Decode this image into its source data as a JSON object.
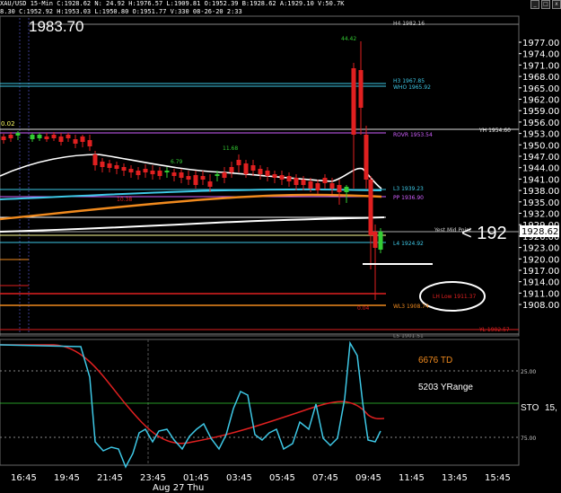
{
  "header": {
    "line1": "XAU/USD  15-Min  C:1928.62  N:  24.92  H:1976.57  L:1909.81  O:1952.39  B:1928.62  A:1929.10  V:50.7K",
    "line2": "8.30  C:1952.92  H:1953.03  L:1950.80  O:1951.77  V:330  08-26-20  2:33"
  },
  "big_price": "1983.70",
  "window_buttons": [
    "_",
    "□",
    "x"
  ],
  "right_axis": [
    "1977.00",
    "1974.00",
    "1971.00",
    "1968.00",
    "1965.00",
    "1962.00",
    "1959.00",
    "1956.00",
    "1953.00",
    "1950.00",
    "1947.00",
    "1944.00",
    "1941.00",
    "1938.00",
    "1935.00",
    "1932.00",
    "1929.00",
    "1926.00",
    "1923.00",
    "1920.00",
    "1917.00",
    "1914.00",
    "1911.00",
    "1908.00"
  ],
  "current_price": "1928.62",
  "level_labels": {
    "h4": "H4  1982.16",
    "h3": "H3  1967.85",
    "who": "WHO  1965.92",
    "yh": "YH  1954.60",
    "rovr": "ROVR  1953.54",
    "l3": "L3  1939.23",
    "pp": "PP  1936.90",
    "l4": "L4  1924.92",
    "wl3": "WL3  1908.74",
    "yl": "YL  1902.57",
    "l5": "L5  1901.51",
    "yest_mid": "Yest Mid Point",
    "lh_low": "LH Low  1911.37",
    "left_cut": "0.02"
  },
  "annotations": {
    "peak": "44.42",
    "a1": "11.68",
    "a2": "6.79",
    "a3": "10.38",
    "a4": "0.04",
    "handwritten": "< 192"
  },
  "indicator": {
    "td_label": "6676 TD",
    "yrange_label": "5203 YRange",
    "sto_label": "STO",
    "sto_value": "15,",
    "level_25": "25.00",
    "level_75": "75.00"
  },
  "time_axis": [
    "16:45",
    "19:45",
    "21:45",
    "23:45",
    "01:45",
    "03:45",
    "05:45",
    "07:45",
    "09:45",
    "11:45",
    "13:45",
    "15:45"
  ],
  "date_label": "Aug 27 Thu",
  "colors": {
    "cyan": "#3ec8e6",
    "red": "#e02020",
    "orange": "#f08a1e",
    "magenta": "#d060ff",
    "white": "#ffffff",
    "green": "#33cc33"
  }
}
